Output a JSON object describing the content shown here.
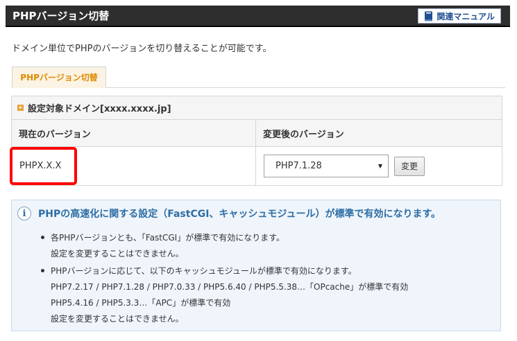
{
  "header": {
    "title": "PHPバージョン切替",
    "manual_label": "関連マニュアル"
  },
  "description": "ドメイン単位でPHPのバージョンを切り替えることが可能です。",
  "tabs": [
    {
      "label": "PHPバージョン切替"
    }
  ],
  "settings": {
    "target_label": "設定対象ドメイン[xxxx.xxxx.jp]",
    "col_current": "現在のバージョン",
    "col_new": "変更後のバージョン",
    "current_version": "PHPX.X.X",
    "selected_version": "PHP7.1.28",
    "change_button": "変更"
  },
  "info": {
    "icon": "i",
    "title": "PHPの高速化に関する設定（FastCGI、キャッシュモジュール）が標準で有効になります。",
    "items": [
      {
        "lines": [
          "各PHPバージョンとも、「FastCGI」が標準で有効になります。",
          "設定を変更することはできません。"
        ]
      },
      {
        "lines": [
          "PHPバージョンに応じて、以下のキャッシュモジュールが標準で有効になります。",
          "PHP7.2.17 / PHP7.1.28 / PHP7.0.33 / PHP5.6.40 / PHP5.5.38…「OPcache」が標準で有効",
          "PHP5.4.16 / PHP5.3.3…「APC」が標準で有効",
          "設定を変更することはできません。"
        ]
      }
    ]
  },
  "colors": {
    "title_bar": "#2e2e2e",
    "tab_text": "#e08a00",
    "highlight": "#ff0000",
    "info_title": "#2e6da4"
  }
}
